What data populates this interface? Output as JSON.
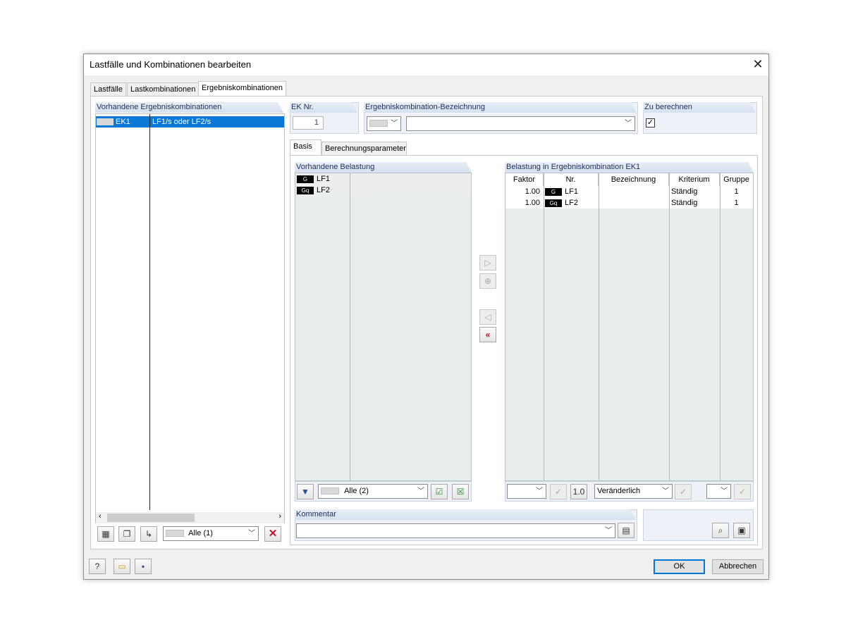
{
  "window": {
    "title": "Lastfälle und Kombinationen bearbeiten",
    "close_glyph": "✕"
  },
  "tabs": [
    {
      "label": "Lastfälle"
    },
    {
      "label": "Lastkombinationen"
    },
    {
      "label": "Ergebniskombinationen"
    }
  ],
  "left_list": {
    "header": "Vorhandene Ergebniskombinationen",
    "rows": [
      {
        "id": "EK1",
        "description": "LF1/s oder LF2/s"
      }
    ],
    "filter": {
      "value": "Alle (1)"
    }
  },
  "ek_nr": {
    "label": "EK Nr.",
    "value": "1"
  },
  "bezeichnung": {
    "label": "Ergebniskombination-Bezeichnung",
    "value": ""
  },
  "zu_berechnen": {
    "label": "Zu berechnen",
    "checked": true,
    "check_glyph": "✓"
  },
  "subtabs": [
    {
      "label": "Basis"
    },
    {
      "label": "Berechnungsparameter"
    }
  ],
  "vorhandene_belastung": {
    "header": "Vorhandene Belastung",
    "rows": [
      {
        "badge": "G",
        "name": "LF1"
      },
      {
        "badge": "Gq",
        "name": "LF2"
      }
    ],
    "filter": {
      "value": "Alle (2)"
    }
  },
  "belastung": {
    "header": "Belastung in Ergebniskombination EK1",
    "columns": [
      "Faktor",
      "Nr.",
      "Bezeichnung",
      "Kriterium",
      "Gruppe"
    ],
    "rows": [
      {
        "faktor": "1.00",
        "badge": "G",
        "nr": "LF1",
        "bezeichnung": "",
        "kriterium": "Ständig",
        "gruppe": "1"
      },
      {
        "faktor": "1.00",
        "badge": "Gq",
        "nr": "LF2",
        "bezeichnung": "",
        "kriterium": "Ständig",
        "gruppe": "1"
      }
    ],
    "factor_button": "1.0",
    "kriterium_combo": "Veränderlich"
  },
  "kommentar": {
    "label": "Kommentar",
    "value": ""
  },
  "buttons": {
    "ok": "OK",
    "cancel": "Abbrechen"
  },
  "colors": {
    "accent": "#0a78d7",
    "header_text": "#1e2d5a",
    "delete_red": "#c8102e"
  }
}
